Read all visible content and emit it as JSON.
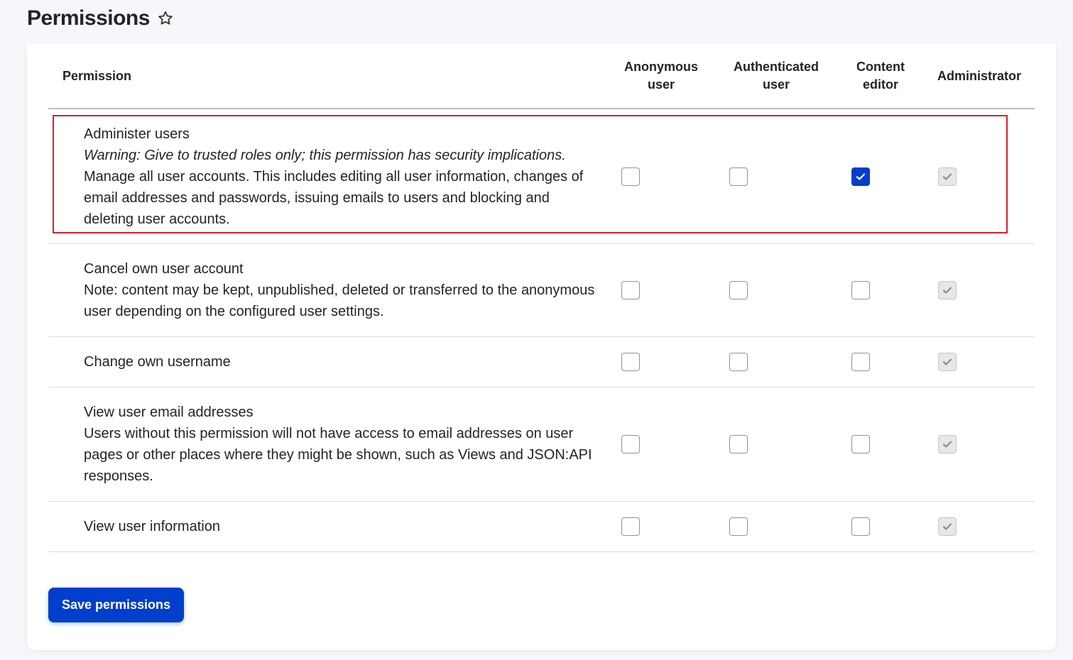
{
  "page": {
    "title": "Permissions"
  },
  "table": {
    "headers": {
      "permission": "Permission",
      "roles": [
        "Anonymous user",
        "Authenticated user",
        "Content editor",
        "Administrator"
      ]
    },
    "rows": [
      {
        "title": "Administer users",
        "warning": "Warning: Give to trusted roles only; this permission has security implications.",
        "description": "Manage all user accounts. This includes editing all user information, changes of email addresses and passwords, issuing emails to users and blocking and deleting user accounts.",
        "checks": [
          false,
          false,
          true,
          true
        ],
        "highlighted": true
      },
      {
        "title": "Cancel own user account",
        "description": "Note: content may be kept, unpublished, deleted or transferred to the anonymous user depending on the configured user settings.",
        "checks": [
          false,
          false,
          false,
          true
        ]
      },
      {
        "title": "Change own username",
        "description": "",
        "checks": [
          false,
          false,
          false,
          true
        ]
      },
      {
        "title": "View user email addresses",
        "description": "Users without this permission will not have access to email addresses on user pages or other places where they might be shown, such as Views and JSON:API responses.",
        "checks": [
          false,
          false,
          false,
          true
        ]
      },
      {
        "title": "View user information",
        "description": "",
        "checks": [
          false,
          false,
          false,
          true
        ]
      }
    ]
  },
  "actions": {
    "save_label": "Save permissions"
  },
  "colors": {
    "accent": "#003ecc",
    "highlight": "#d6202c"
  },
  "icons": {
    "favorite": "star-outline-icon",
    "check": "checkmark-icon"
  }
}
